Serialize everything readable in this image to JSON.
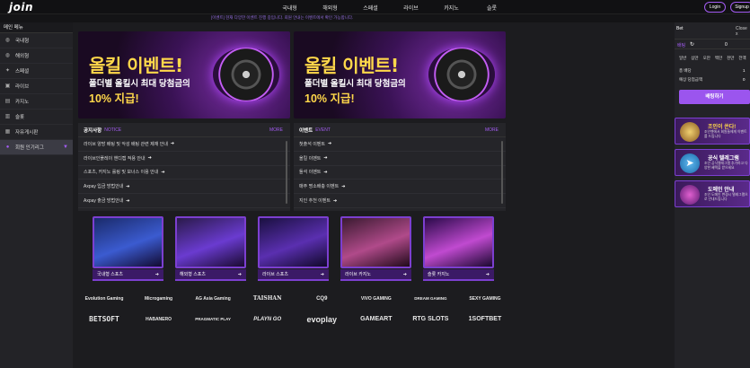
{
  "brand": {
    "logo": "join"
  },
  "topnav": [
    "국내형",
    "해외형",
    "스페셜",
    "라이브",
    "카지노",
    "슬롯"
  ],
  "auth": {
    "login": "Login",
    "signup": "Signup"
  },
  "notice_text": "[이벤트] 현재 다양한 이벤트 진행 중입니다. 회원 안내는 이벤트에서 확인 가능합니다.",
  "sidebar": {
    "header": "메인 메뉴",
    "items": [
      {
        "label": "국내형",
        "icon": "globe-icon"
      },
      {
        "label": "해외형",
        "icon": "globe-icon"
      },
      {
        "label": "스페셜",
        "icon": "star-icon"
      },
      {
        "label": "라이브",
        "icon": "live-icon"
      },
      {
        "label": "카지노",
        "icon": "card-icon"
      },
      {
        "label": "슬롯",
        "icon": "slot-icon"
      },
      {
        "label": "자유게시판",
        "icon": "board-icon"
      },
      {
        "label": "회원 인기리그",
        "icon": "league-icon"
      }
    ]
  },
  "banners": [
    {
      "title": "올킬 이벤트!",
      "line2": "폴더별 올킬시 최대 당첨금의",
      "line3": "10% 지급!"
    },
    {
      "title": "올킬 이벤트!",
      "line2": "폴더별 올킬시 최대 당첨금의",
      "line3": "10% 지급!"
    }
  ],
  "notice_panel": {
    "title": "공지사항",
    "sub": "NOTICE",
    "more": "MORE",
    "rows": [
      "라이브 양방 배팅 및 악성 배팅 관련 제재 안내",
      "라이브인플레이 핸디캡 적용 안내",
      "스포츠, 카지노 롤링 및 보너스 이용 안내",
      "Axpay 입금 방법안내",
      "Axpay 출금 방법안내"
    ]
  },
  "event_panel": {
    "title": "이벤트",
    "sub": "EVENT",
    "more": "MORE",
    "rows": [
      "첫출석 이벤트",
      "올킬 이벤트",
      "돌석 이벤트",
      "매주 명소배충 이벤트",
      "지인 추천 이벤트"
    ]
  },
  "game_cards": [
    {
      "label": "국내형 스포츠",
      "colors": [
        "#1a2a6a",
        "#3b5bd0"
      ]
    },
    {
      "label": "해외형 스포츠",
      "colors": [
        "#2a1a4a",
        "#6a3bd0"
      ]
    },
    {
      "label": "라이브 스포츠",
      "colors": [
        "#1a1040",
        "#5a2fb0"
      ]
    },
    {
      "label": "라이브 카지노",
      "colors": [
        "#3a1a30",
        "#b04a8a"
      ]
    },
    {
      "label": "슬롯 카지노",
      "colors": [
        "#2a0a4a",
        "#c04ad0"
      ]
    }
  ],
  "provider_logos": [
    [
      "Evolution Gaming",
      "Microgaming",
      "AG Asia Gaming",
      "TAISHAN",
      "CQ9",
      "VIVO GAMING",
      "DREAM GAMING",
      "SEXY GAMING"
    ],
    [
      "BETSOFT",
      "HABANERO",
      "PRAGMATIC PLAY",
      "PLAYN GO",
      "evoplay",
      "GAMEART",
      "RTG SLOTS",
      "1SOFTBET"
    ]
  ],
  "betslip": {
    "title": "Bet",
    "close": "Close x",
    "mode": "배팅",
    "amount": "0",
    "chips": [
      "일반",
      "삼만",
      "오만",
      "백만",
      "천만",
      "전액"
    ],
    "total_label": "총 배당",
    "total_value": "1",
    "expected_label": "예상 당첨금액",
    "expected_value": "0",
    "submit": "배팅하기"
  },
  "promos": [
    {
      "title": "조인이 쏜다!",
      "sub": "조인벳에서 회원들에게 이벤트를 드립니다",
      "icon": "gift-icon"
    },
    {
      "title": "공식 텔레그램",
      "sub": "조인 공식텔레그램 추가하고 다양한 혜택을 받으세요",
      "icon": "telegram-icon"
    },
    {
      "title": "도메인 안내",
      "sub": "조인 도메인 변경시 텔레그램으로 안내드립니다",
      "icon": "domain-icon"
    }
  ]
}
